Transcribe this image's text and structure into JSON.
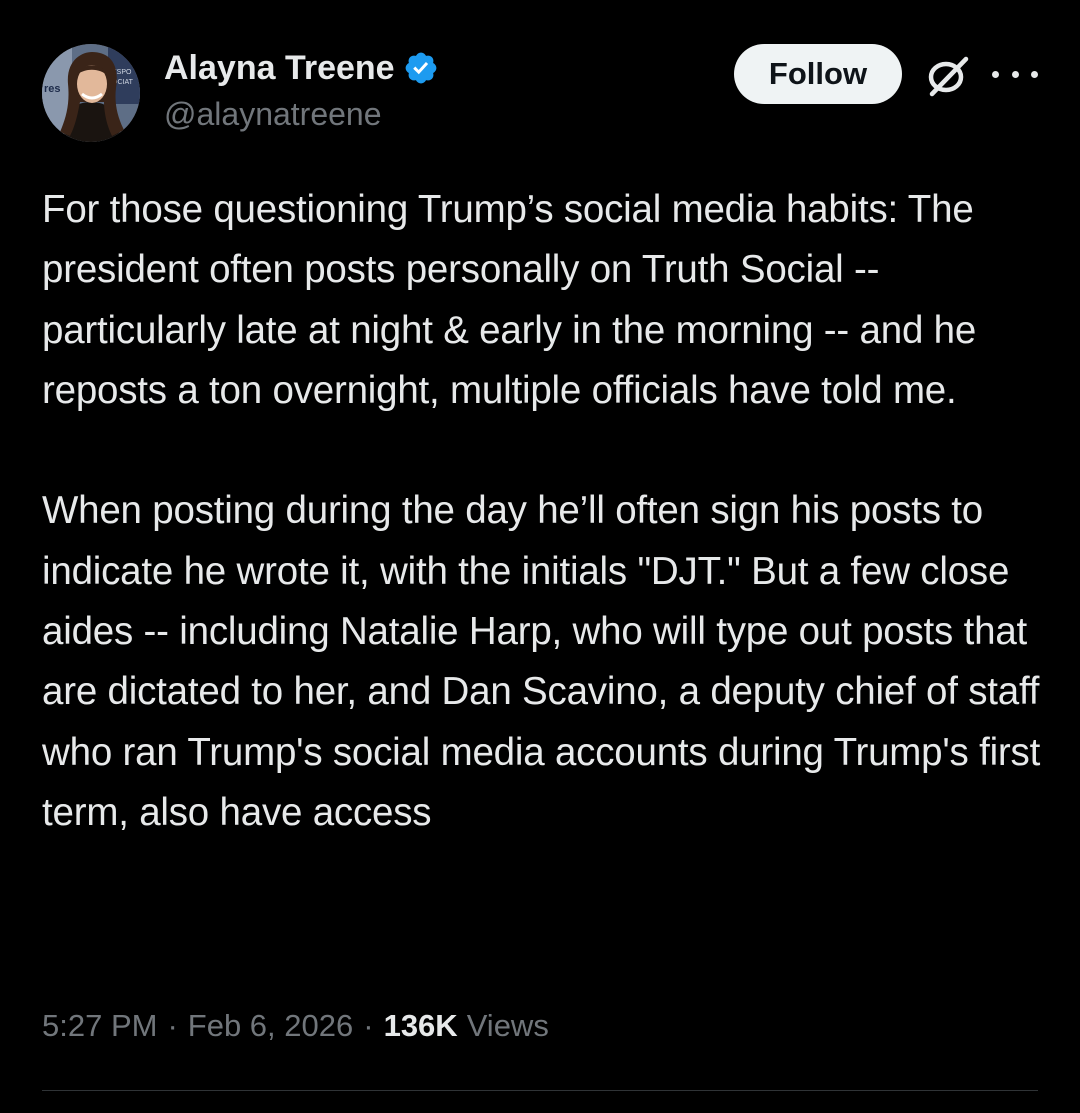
{
  "author": {
    "display_name": "Alayna Treene",
    "handle": "@alaynatreene",
    "verified": true,
    "avatar_icon": "profile-photo"
  },
  "actions": {
    "follow_label": "Follow",
    "grok_icon": "grok-icon",
    "more_icon": "more-options-icon"
  },
  "tweet": {
    "text": "For those questioning Trump’s social media habits: The president often posts personally on Truth Social -- particularly late at night & early in the morning -- and he reposts a ton overnight, multiple officials have told me.\n\nWhen posting during the day he’ll often sign his posts to indicate he wrote it, with the initials \"DJT.\" But a few close aides -- including Natalie Harp, who will type out posts that are dictated to her, and Dan Scavino, a deputy chief of staff who ran Trump's social media accounts during Trump's first term, also have access"
  },
  "meta": {
    "time": "5:27 PM",
    "separator": "·",
    "date": "Feb 6, 2026",
    "views_count": "136K",
    "views_label": "Views"
  },
  "colors": {
    "background": "#000000",
    "text_primary": "#e7e9ea",
    "text_secondary": "#71767b",
    "verified_blue": "#1d9bf0",
    "follow_bg": "#eff3f4",
    "divider": "#2f3336"
  }
}
